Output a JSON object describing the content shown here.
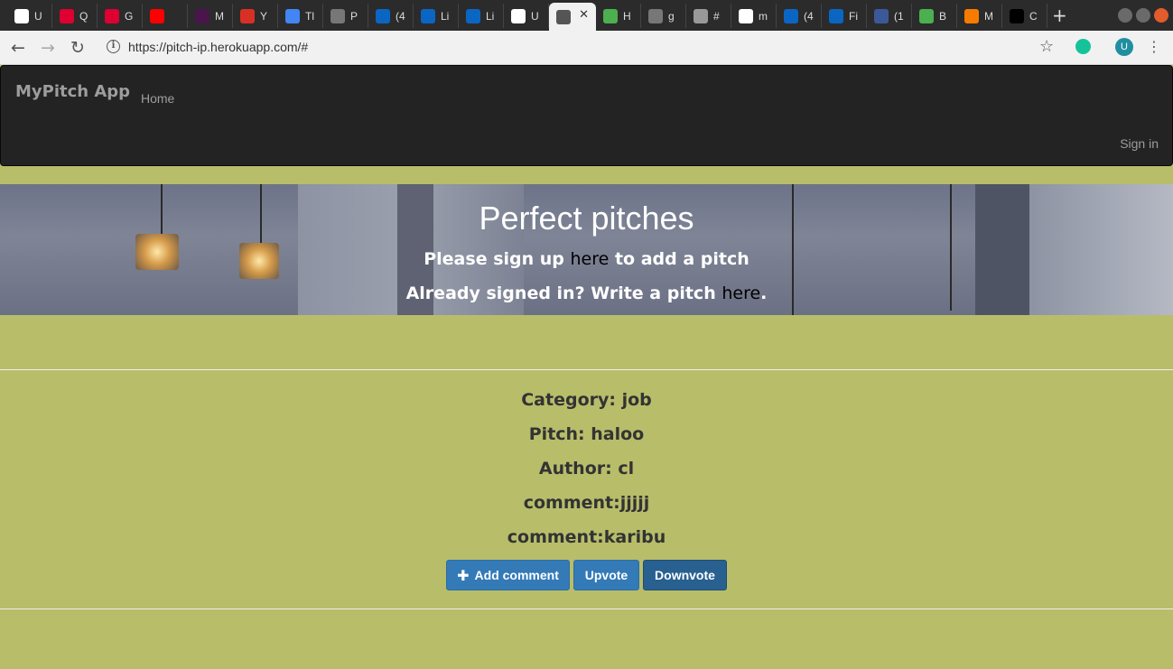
{
  "browser": {
    "tabs": [
      {
        "icon": "github-icon",
        "label": "U",
        "color": "#ffffff"
      },
      {
        "icon": "angular-icon",
        "label": "Q",
        "color": "#dd0031"
      },
      {
        "icon": "angular-icon",
        "label": "G",
        "color": "#dd0031"
      },
      {
        "icon": "youtube-icon",
        "label": "",
        "color": "#ff0000"
      },
      {
        "icon": "slack-icon",
        "label": "M",
        "color": "#4a154b"
      },
      {
        "icon": "gmail-icon",
        "label": "Y",
        "color": "#d93025"
      },
      {
        "icon": "page-icon",
        "label": "Tl",
        "color": "#4285f4"
      },
      {
        "icon": "globe-icon",
        "label": "P",
        "color": "#777777"
      },
      {
        "icon": "linkedin-icon",
        "label": "(4",
        "color": "#0a66c2"
      },
      {
        "icon": "linkedin-icon",
        "label": "Li",
        "color": "#0a66c2"
      },
      {
        "icon": "linkedin-icon",
        "label": "Li",
        "color": "#0a66c2"
      },
      {
        "icon": "github-icon",
        "label": "U",
        "color": "#ffffff"
      },
      {
        "icon": "globe-icon",
        "label": "",
        "color": "#555555",
        "active": true
      },
      {
        "icon": "w3-icon",
        "label": "H",
        "color": "#4caf50"
      },
      {
        "icon": "globe-icon",
        "label": "g",
        "color": "#777777"
      },
      {
        "icon": "code-icon",
        "label": "#",
        "color": "#999999"
      },
      {
        "icon": "github-icon",
        "label": "m",
        "color": "#ffffff"
      },
      {
        "icon": "linkedin-icon",
        "label": "(4",
        "color": "#0a66c2"
      },
      {
        "icon": "linkedin-icon",
        "label": "Fi",
        "color": "#0a66c2"
      },
      {
        "icon": "facebook-icon",
        "label": "(1",
        "color": "#3b5998"
      },
      {
        "icon": "w3-icon",
        "label": "B",
        "color": "#4caf50"
      },
      {
        "icon": "sun-icon",
        "label": "M",
        "color": "#f57c00"
      },
      {
        "icon": "codepen-icon",
        "label": "C",
        "color": "#000000"
      }
    ],
    "url": "https://pitch-ip.herokuapp.com/#",
    "avatar_letter": "U"
  },
  "navbar": {
    "brand": "MyPitch App",
    "home": "Home",
    "signin": "Sign in"
  },
  "hero": {
    "title": "Perfect pitches",
    "line1_pre": "Please sign up ",
    "line1_link": "here",
    "line1_post": " to add a pitch",
    "line2_pre": "Already signed in? Write a pitch ",
    "line2_link": "here",
    "line2_post": "."
  },
  "pitch": {
    "category": "Category: job",
    "pitch": "Pitch: haloo",
    "author": "Author: cl",
    "comments": [
      "comment:jjjjj",
      "comment:karibu"
    ]
  },
  "buttons": {
    "add_comment": "Add comment",
    "upvote": "Upvote",
    "downvote": "Downvote"
  }
}
